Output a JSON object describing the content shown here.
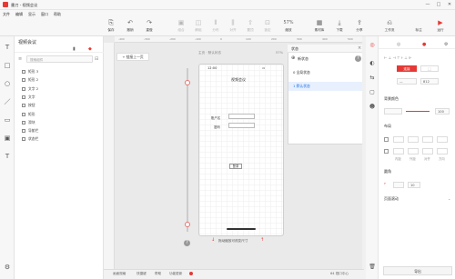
{
  "window": {
    "title": "墨刀 - 视频会议",
    "controls": [
      "—",
      "□",
      "✕"
    ]
  },
  "menu": [
    "文件",
    "编辑",
    "显示",
    "窗口",
    "帮助"
  ],
  "toolbar": {
    "items": [
      {
        "label": "保存",
        "icon": "save-icon",
        "glyph": "⎘",
        "enabled": true
      },
      {
        "label": "撤销",
        "icon": "undo-icon",
        "glyph": "↶",
        "enabled": true
      },
      {
        "label": "重做",
        "icon": "redo-icon",
        "glyph": "↷",
        "enabled": true
      },
      {
        "label": "组合",
        "icon": "group-icon",
        "glyph": "▣",
        "enabled": false
      },
      {
        "label": "解组",
        "icon": "ungroup-icon",
        "glyph": "◫",
        "enabled": false
      },
      {
        "label": "分布",
        "icon": "distribute-icon",
        "glyph": "⫴",
        "enabled": false
      },
      {
        "label": "对齐",
        "icon": "align-icon",
        "glyph": "⫼",
        "enabled": false
      },
      {
        "label": "置顶",
        "icon": "bring-front-icon",
        "glyph": "⇧",
        "enabled": false
      },
      {
        "label": "锁定",
        "icon": "lock-icon",
        "glyph": "⊡",
        "enabled": false
      }
    ],
    "zoom_label": "缩放",
    "zoom_value": "57%",
    "right": [
      {
        "label": "素材库",
        "icon": "library-icon",
        "glyph": "▦"
      },
      {
        "label": "下载",
        "icon": "download-icon",
        "glyph": "⤓"
      },
      {
        "label": "分享",
        "icon": "share-icon",
        "glyph": "⇪"
      }
    ],
    "far_right": [
      {
        "label": "工作流",
        "icon": "workflow-icon",
        "glyph": "⎌"
      },
      {
        "label": "标注",
        "icon": "annotate-icon",
        "glyph": "</>"
      },
      {
        "label": "运行",
        "icon": "play-icon",
        "glyph": "▶"
      }
    ]
  },
  "left_tools": [
    "T",
    "□",
    "○",
    "／",
    "▭",
    "▣",
    "T"
  ],
  "pages_panel": {
    "title": "视频会议",
    "search_placeholder": "搜索组件",
    "layers": [
      "矩形 3",
      "矩形 2",
      "文字 2",
      "文字",
      "按钮",
      "矩形",
      "滑块",
      "导航栏",
      "状态栏"
    ]
  },
  "canvas": {
    "ruler_marks": [
      "-400",
      "-300",
      "-200",
      "-100",
      "0",
      "100",
      "200",
      "300",
      "400",
      "500"
    ],
    "add_button": "+ 链接上一页",
    "page_label": "主页 · 默认状态",
    "zoom": "57%",
    "phone": {
      "time": "12:00",
      "title": "视频会议",
      "label_account": "账户名",
      "label_password": "密码",
      "button": "登录"
    },
    "hint": "拖动缩放可改变尺寸",
    "help": "?"
  },
  "states_panel": {
    "header": "状态",
    "add_label": "新状态",
    "items": [
      {
        "label": "0 全局状态",
        "selected": false
      },
      {
        "label": "1 默认状态",
        "selected": true
      }
    ]
  },
  "statusbar": [
    "画面规格",
    "快捷键",
    "帮助",
    "功能更新"
  ],
  "statusbar_right": "64 视口中心",
  "right_panel": {
    "tabs": [
      "◎",
      "●",
      "⚙"
    ],
    "fill_on": "连接",
    "fill_field": "—",
    "height_value": "812",
    "opacity_label": "背景颜色",
    "opacity_value": "100",
    "stroke_label": "布局",
    "stroke_sub": [
      "内距",
      "外距",
      "对齐",
      "方向"
    ],
    "effects_label": "圆角",
    "radius_value": "10",
    "page_label": "页面滚动",
    "export_label": "导出"
  },
  "colors": {
    "accent": "#e53935",
    "selection": "#1a73e8"
  }
}
